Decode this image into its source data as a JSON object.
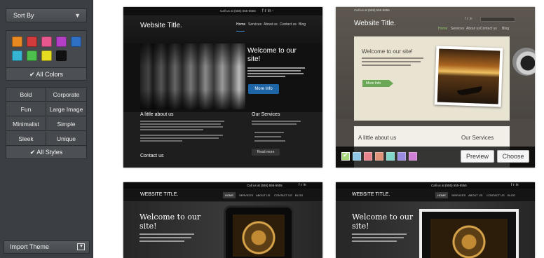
{
  "sidebar": {
    "sort_label": "Sort By",
    "colors": [
      "#e9891f",
      "#d23b3b",
      "#e8578e",
      "#b23fc6",
      "#2f6fc4",
      "#33b5d3",
      "#4cbf4c",
      "#e6dc21",
      "#111111"
    ],
    "all_colors_label": "All Colors",
    "styles": [
      "Bold",
      "Corporate",
      "Fun",
      "Large Image",
      "Minimalist",
      "Simple",
      "Sleek",
      "Unique"
    ],
    "all_styles_label": "All Styles",
    "import_label": "Import Theme"
  },
  "themes": [
    {
      "site_title": "Website Title.",
      "contact": "Call us at (555) 555-5555",
      "nav": [
        "Home",
        "Services",
        "About us",
        "Contact us",
        "Blog"
      ],
      "hero_heading_1": "Welcome to our",
      "hero_heading_2": "site!",
      "hero_button": "More Info",
      "about_heading": "A little about us",
      "services_heading": "Our Services",
      "read_more": "Read more",
      "contact_heading": "Contact us"
    },
    {
      "site_title": "Website Title.",
      "contact": "Call us at (555) 555-5555",
      "nav": [
        "Home",
        "Services",
        "About us",
        "Contact us",
        "Blog"
      ],
      "hero_heading": "Welcome to our site!",
      "hero_button": "More Info",
      "about_heading": "A little about us",
      "services_heading": "Our Services",
      "preview_label": "Preview",
      "choose_label": "Choose",
      "palette": [
        "#a8d67a",
        "#8fc6e6",
        "#e8848c",
        "#e0957a",
        "#7fd6c9",
        "#9a8ce0",
        "#d07fd6"
      ]
    },
    {
      "site_title": "WEBSITE TITLE.",
      "contact": "Call us at (555) 555-5555",
      "nav": [
        "HOME",
        "SERVICES",
        "ABOUT US",
        "CONTACT US",
        "BLOG"
      ],
      "hero_heading_1": "Welcome to our",
      "hero_heading_2": "site!"
    },
    {
      "site_title": "WEBSITE TITLE.",
      "contact": "Call us at (555) 555-5555",
      "nav": [
        "HOME",
        "SERVICES",
        "ABOUT US",
        "CONTACT US",
        "BLOG"
      ],
      "hero_heading_1": "Welcome to our",
      "hero_heading_2": "site!"
    }
  ]
}
